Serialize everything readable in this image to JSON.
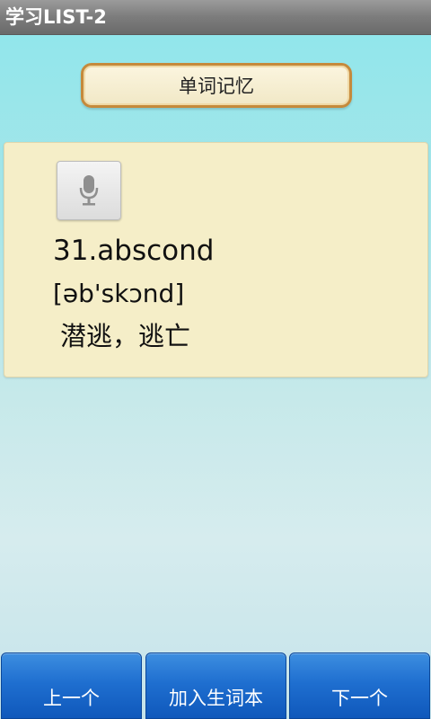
{
  "titlebar": {
    "title": "学习LIST-2"
  },
  "header": {
    "label": "单词记忆"
  },
  "card": {
    "mic_icon": "microphone-icon",
    "word": "31.abscond",
    "phonetic": "[əb'skɔnd]",
    "meaning": "潜逃，逃亡"
  },
  "bottom_nav": {
    "prev_label": "上一个",
    "add_label": "加入生词本",
    "next_label": "下一个"
  },
  "colors": {
    "titlebar": "#7c7c7c",
    "header_border": "#c58a3c",
    "card_bg": "#f5eec8",
    "nav_button": "#1f6fd0"
  }
}
